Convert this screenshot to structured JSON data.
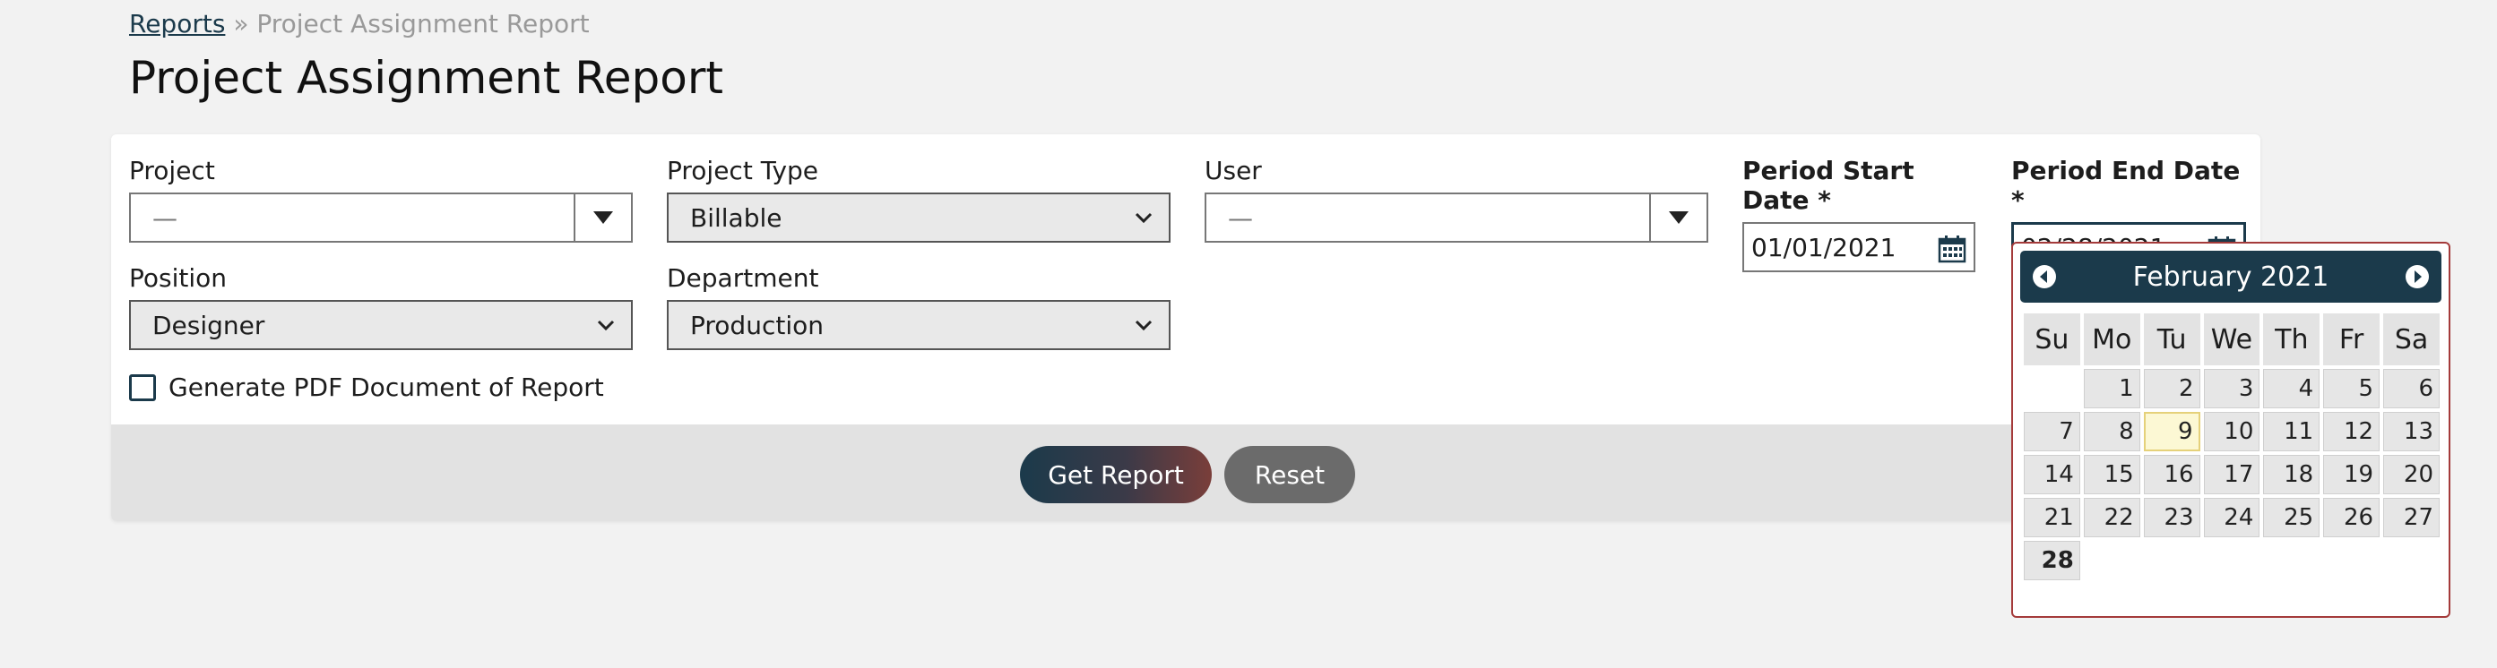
{
  "breadcrumb": {
    "link": "Reports",
    "separator": "»",
    "current": "Project Assignment Report"
  },
  "page_title": "Project Assignment Report",
  "form": {
    "project": {
      "label": "Project",
      "value": "—"
    },
    "project_type": {
      "label": "Project Type",
      "value": "Billable"
    },
    "user": {
      "label": "User",
      "value": "—"
    },
    "period_start": {
      "label": "Period Start Date *",
      "value": "01/01/2021"
    },
    "period_end": {
      "label": "Period End Date *",
      "value": "02/28/2021"
    },
    "position": {
      "label": "Position",
      "value": "Designer"
    },
    "department": {
      "label": "Department",
      "value": "Production"
    },
    "generate_pdf": {
      "label": "Generate PDF Document of Report",
      "checked": false
    }
  },
  "buttons": {
    "get_report": "Get Report",
    "reset": "Reset"
  },
  "datepicker": {
    "title": "February 2021",
    "weekdays": [
      "Su",
      "Mo",
      "Tu",
      "We",
      "Th",
      "Fr",
      "Sa"
    ],
    "weeks": [
      [
        "",
        "1",
        "2",
        "3",
        "4",
        "5",
        "6"
      ],
      [
        "7",
        "8",
        "9",
        "10",
        "11",
        "12",
        "13"
      ],
      [
        "14",
        "15",
        "16",
        "17",
        "18",
        "19",
        "20"
      ],
      [
        "21",
        "22",
        "23",
        "24",
        "25",
        "26",
        "27"
      ],
      [
        "28",
        "",
        "",
        "",
        "",
        "",
        ""
      ]
    ],
    "today": "9",
    "selected": "28"
  },
  "colors": {
    "primary": "#1b3a4b",
    "accent": "#a43a3a",
    "today_bg": "#fcf8d4"
  }
}
